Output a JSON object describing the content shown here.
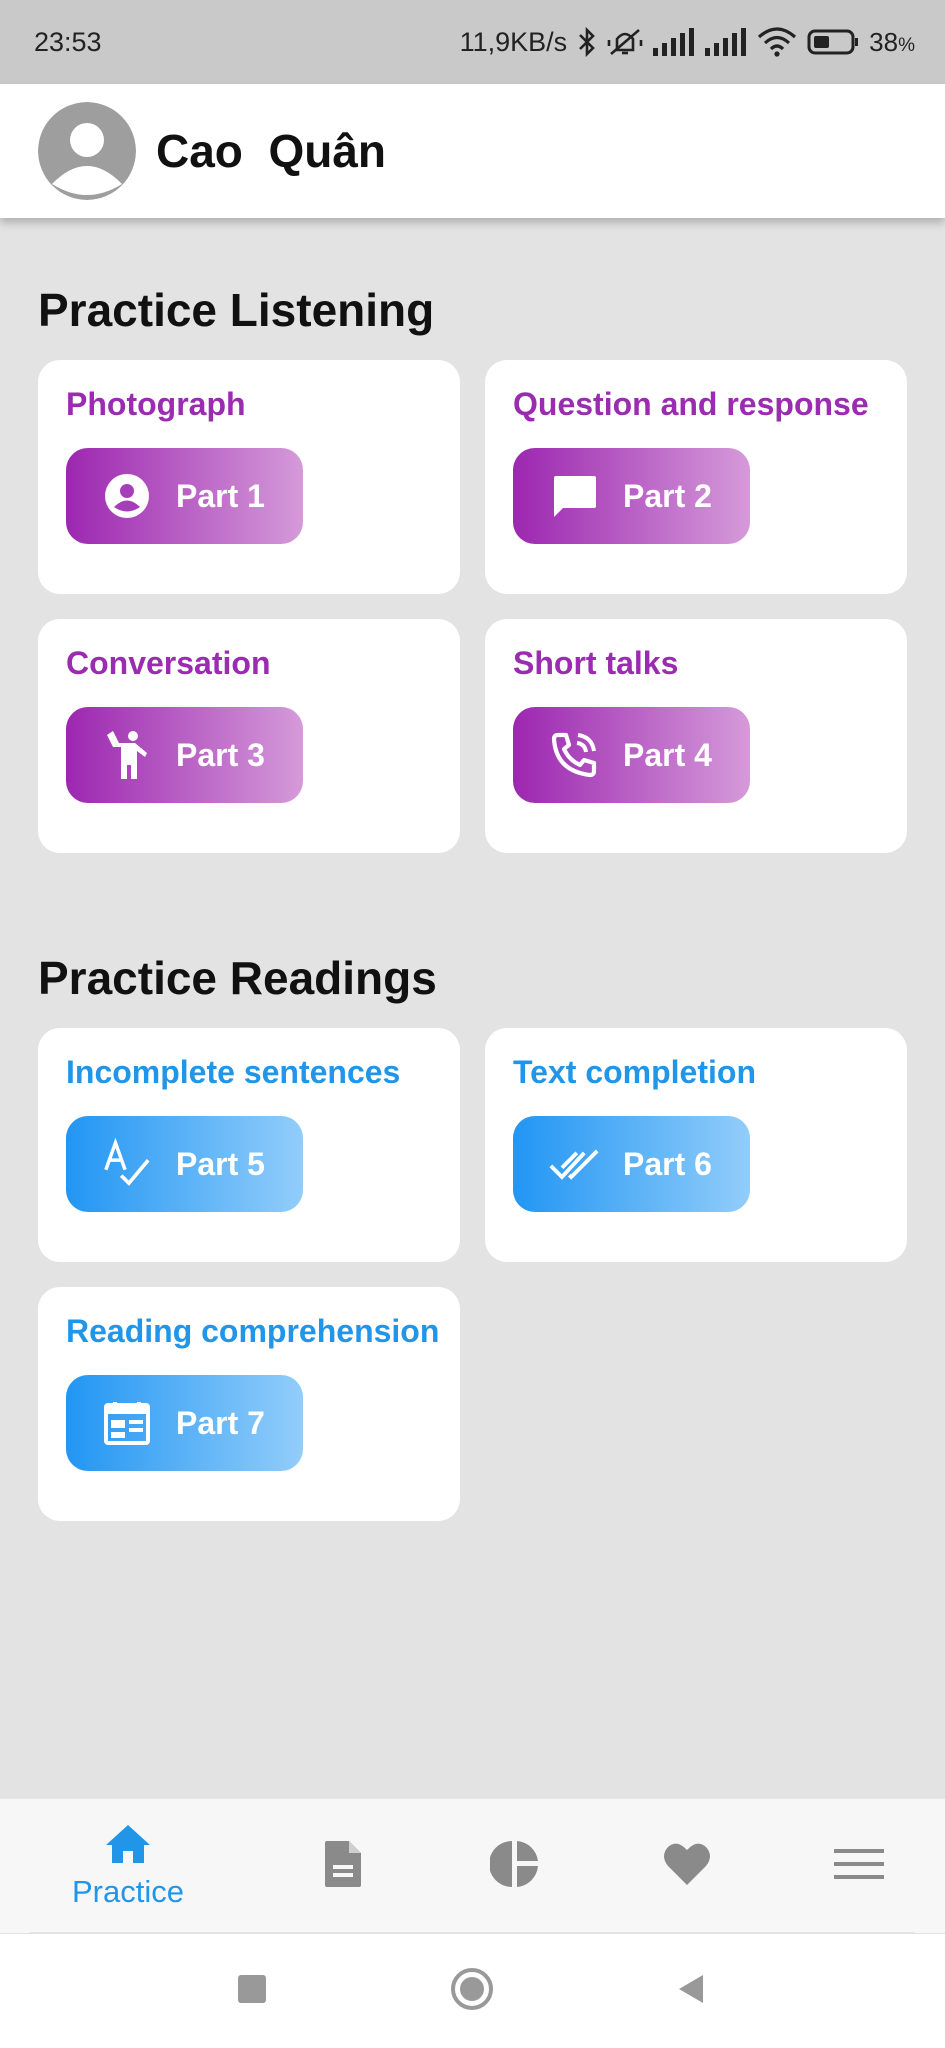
{
  "status_bar": {
    "time": "23:53",
    "network_speed": "11,9KB/s",
    "battery": "38",
    "battery_unit": "%"
  },
  "user": {
    "name": "Cao  Quân"
  },
  "listening": {
    "title": "Practice Listening",
    "items": [
      {
        "title": "Photograph",
        "button": "Part 1",
        "icon": "person-icon"
      },
      {
        "title": "Question and response",
        "button": "Part 2",
        "icon": "chat-bubble-icon"
      },
      {
        "title": "Conversation",
        "button": "Part 3",
        "icon": "person-waving-icon"
      },
      {
        "title": "Short talks",
        "button": "Part 4",
        "icon": "phone-ringing-icon"
      }
    ]
  },
  "reading": {
    "title": "Practice Readings",
    "items": [
      {
        "title": "Incomplete sentences",
        "button": "Part 5",
        "icon": "spellcheck-icon"
      },
      {
        "title": "Text completion",
        "button": "Part 6",
        "icon": "double-check-icon"
      },
      {
        "title": "Reading comprehension",
        "button": "Part 7",
        "icon": "calendar-table-icon"
      }
    ]
  },
  "bottom_nav": {
    "active_label": "Practice",
    "items": [
      "home-icon",
      "document-icon",
      "pie-chart-icon",
      "heart-icon",
      "menu-icon"
    ]
  },
  "colors": {
    "listening_accent": "#9b2bb0",
    "reading_accent": "#2196e8",
    "background": "#e3e3e3"
  }
}
